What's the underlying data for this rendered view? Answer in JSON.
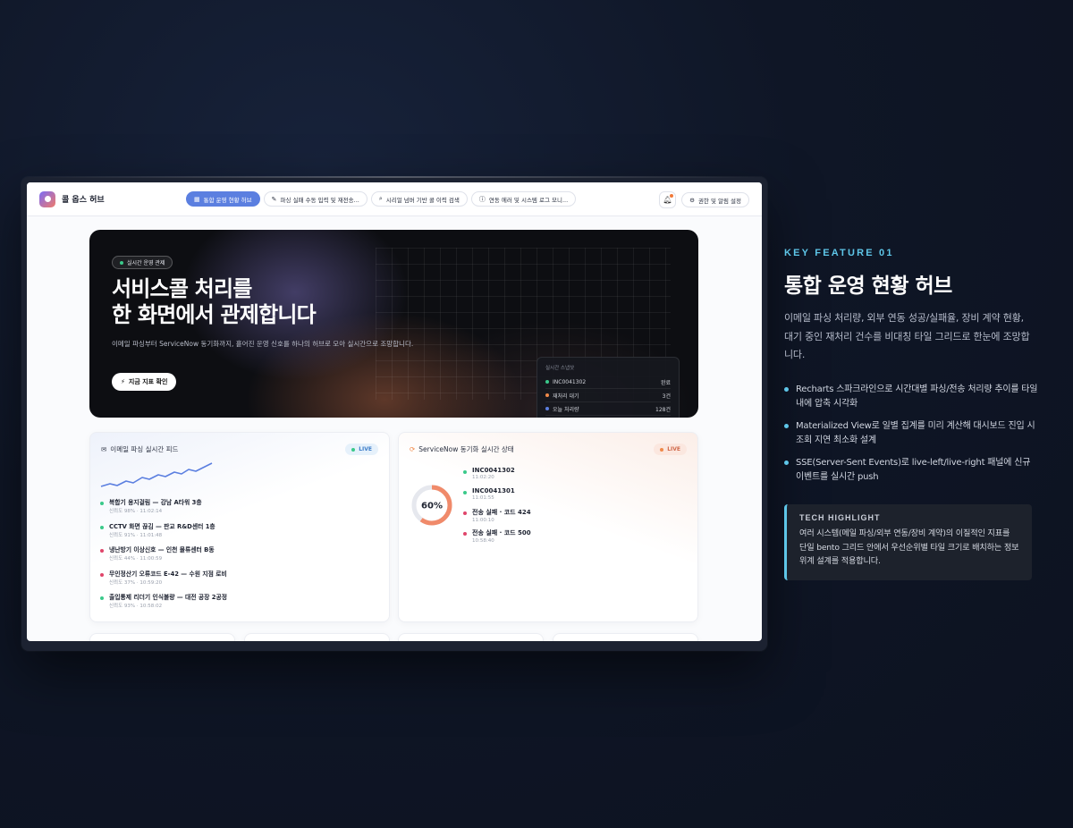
{
  "nav": {
    "logo_text": "콜 옵스 허브",
    "tabs": [
      {
        "label": "통합 운영 현황 허브",
        "icon": "grid-icon",
        "active": true
      },
      {
        "label": "파싱 실패 수동 입력 및 재전송...",
        "icon": "pencil-icon",
        "active": false
      },
      {
        "label": "시리얼 넘버 기반 콜 이력 검색",
        "icon": "search-icon",
        "active": false
      },
      {
        "label": "연동 에러 및 시스템 로그 모니...",
        "icon": "alert-circle-icon",
        "active": false
      }
    ],
    "settings_label": "권한 및 알림 설정"
  },
  "hero": {
    "badge": "실시간 운영 관제",
    "title_line1": "서비스콜 처리를",
    "title_line2": "한 화면에서 관제합니다",
    "subtitle": "이메일 파싱부터 ServiceNow 동기화까지, 흩어진 운영 신호를 하나의 허브로 모아 실시간으로 조망합니다.",
    "cta": "지금 지표 확인",
    "status_panel": {
      "title": "실시간 스냅샷",
      "rows": [
        {
          "label": "INC0041302",
          "value": "완료",
          "color": "#3ac98a"
        },
        {
          "label": "재처리 대기",
          "value": "3건",
          "color": "#f08a4a"
        },
        {
          "label": "오늘 처리량",
          "value": "128건",
          "color": "#5b7fe0"
        }
      ]
    }
  },
  "email_card": {
    "title": "이메일 파싱 실시간 피드",
    "live": "LIVE",
    "items": [
      {
        "title": "복합기 용지걸림 — 강남 A타워 3층",
        "meta": "신뢰도 98% · 11:02:14",
        "color": "#3ac98a"
      },
      {
        "title": "CCTV 화면 끊김 — 판교 R&D센터 1층",
        "meta": "신뢰도 91% · 11:01:48",
        "color": "#3ac98a"
      },
      {
        "title": "냉난방기 이상신호 — 인천 물류센터 B동",
        "meta": "신뢰도 44% · 11:00:59",
        "color": "#e0456a"
      },
      {
        "title": "무인정산기 오류코드 E-42 — 수원 지점 로비",
        "meta": "신뢰도 37% · 10:59:20",
        "color": "#e0456a"
      },
      {
        "title": "출입통제 리더기 인식불량 — 대전 공장 2공정",
        "meta": "신뢰도 93% · 10:58:02",
        "color": "#3ac98a"
      }
    ]
  },
  "sn_card": {
    "title": "ServiceNow 동기화 실시간 상태",
    "live": "LIVE",
    "progress": 60,
    "progress_label": "60%",
    "items": [
      {
        "title": "INC0041302",
        "meta": "11:02:20",
        "color": "#3ac98a"
      },
      {
        "title": "INC0041301",
        "meta": "11:01:55",
        "color": "#3ac98a"
      },
      {
        "title": "전송 실패 · 코드 424",
        "meta": "11:00:10",
        "color": "#e0456a"
      },
      {
        "title": "전송 실패 · 코드 500",
        "meta": "10:58:40",
        "color": "#e0456a"
      }
    ]
  },
  "feature": {
    "kicker": "KEY FEATURE 01",
    "title": "통합 운영 현황 허브",
    "desc": "이메일 파싱 처리량, 외부 연동 성공/실패율, 장비 계약 현황, 대기 중인 재처리 건수를 비대칭 타일 그리드로 한눈에 조망합니다.",
    "bullets": [
      "Recharts 스파크라인으로 시간대별 파싱/전송 처리량 추이를 타일 내에 압축 시각화",
      "Materialized View로 일별 집계를 미리 계산해 대시보드 진입 시 조회 지연 최소화 설계",
      "SSE(Server-Sent Events)로 live-left/live-right 패널에 신규 이벤트를 실시간 push"
    ],
    "tech_title": "TECH HIGHLIGHT",
    "tech_body": "여러 시스템(메일 파싱/외부 연동/장비 계약)의 이질적인 지표를 단일 bento 그리드 안에서 우선순위별 타일 크기로 배치하는 정보 위계 설계를 적용합니다."
  },
  "colors": {
    "accent": "#5ec6e8",
    "active_tab": "#5b7fe0",
    "success": "#3ac98a",
    "danger": "#e0456a",
    "warning": "#f08a4a"
  }
}
